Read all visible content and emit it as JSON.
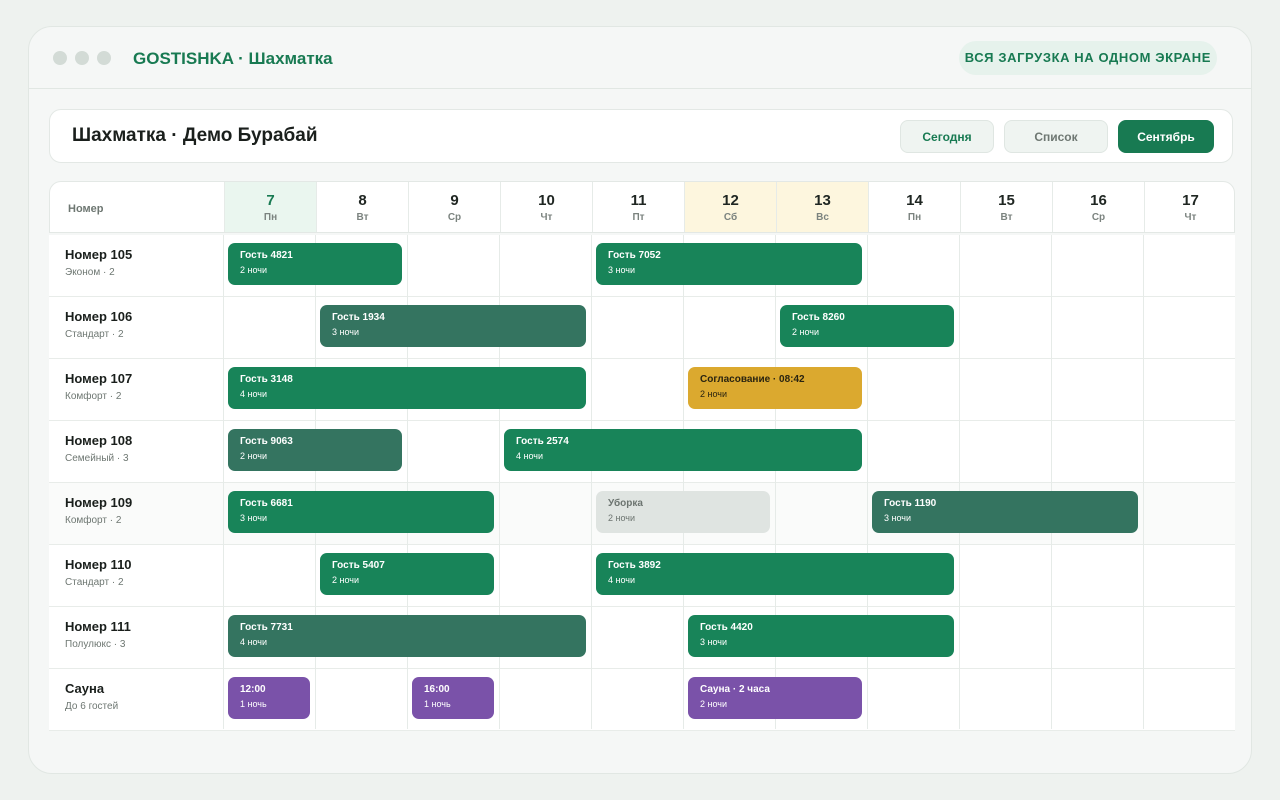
{
  "app": {
    "title": "GOSTISHKA · Шахматка",
    "tagline": "ВСЯ ЗАГРУЗКА НА ОДНОМ ЭКРАНЕ"
  },
  "toolbar": {
    "title": "Шахматка · Демо Бурабай",
    "today_label": "Сегодня",
    "list_label": "Список",
    "month_label": "Сентябрь"
  },
  "grid": {
    "room_header": "Номер",
    "days": [
      {
        "num": "7",
        "dow": "Пн",
        "state": "today"
      },
      {
        "num": "8",
        "dow": "Вт",
        "state": ""
      },
      {
        "num": "9",
        "dow": "Ср",
        "state": ""
      },
      {
        "num": "10",
        "dow": "Чт",
        "state": ""
      },
      {
        "num": "11",
        "dow": "Пт",
        "state": ""
      },
      {
        "num": "12",
        "dow": "Сб",
        "state": "weekend"
      },
      {
        "num": "13",
        "dow": "Вс",
        "state": "weekend"
      },
      {
        "num": "14",
        "dow": "Пн",
        "state": ""
      },
      {
        "num": "15",
        "dow": "Вт",
        "state": ""
      },
      {
        "num": "16",
        "dow": "Ср",
        "state": ""
      },
      {
        "num": "17",
        "dow": "Чт",
        "state": ""
      }
    ],
    "rooms": [
      {
        "name": "Номер 105",
        "sub": "Эконом · 2",
        "bookings": [
          {
            "title": "Гость 4821",
            "sub": "2 ночи",
            "start": 0,
            "span": 2,
            "color": "green"
          },
          {
            "title": "Гость 7052",
            "sub": "3 ночи",
            "start": 4,
            "span": 3,
            "color": "green"
          }
        ]
      },
      {
        "name": "Номер 106",
        "sub": "Стандарт · 2",
        "bookings": [
          {
            "title": "Гость 1934",
            "sub": "3 ночи",
            "start": 1,
            "span": 3,
            "color": "dark"
          },
          {
            "title": "Гость 8260",
            "sub": "2 ночи",
            "start": 6,
            "span": 2,
            "color": "green"
          }
        ]
      },
      {
        "name": "Номер 107",
        "sub": "Комфорт · 2",
        "bookings": [
          {
            "title": "Гость 3148",
            "sub": "4 ночи",
            "start": 0,
            "span": 4,
            "color": "green"
          },
          {
            "title": "Согласование · 08:42",
            "sub": "2 ночи",
            "start": 5,
            "span": 2,
            "color": "yellow"
          }
        ]
      },
      {
        "name": "Номер 108",
        "sub": "Семейный · 3",
        "bookings": [
          {
            "title": "Гость 9063",
            "sub": "2 ночи",
            "start": 0,
            "span": 2,
            "color": "dark"
          },
          {
            "title": "Гость 2574",
            "sub": "4 ночи",
            "start": 3,
            "span": 4,
            "color": "green"
          }
        ]
      },
      {
        "name": "Номер 109",
        "sub": "Комфорт · 2",
        "bookings": [
          {
            "title": "Гость 6681",
            "sub": "3 ночи",
            "start": 0,
            "span": 3,
            "color": "green"
          },
          {
            "title": "Уборка",
            "sub": "2 ночи",
            "start": 4,
            "span": 2,
            "color": "grey"
          },
          {
            "title": "Гость 1190",
            "sub": "3 ночи",
            "start": 7,
            "span": 3,
            "color": "dark"
          }
        ]
      },
      {
        "name": "Номер 110",
        "sub": "Стандарт · 2",
        "bookings": [
          {
            "title": "Гость 5407",
            "sub": "2 ночи",
            "start": 1,
            "span": 2,
            "color": "green"
          },
          {
            "title": "Гость 3892",
            "sub": "4 ночи",
            "start": 4,
            "span": 4,
            "color": "green"
          }
        ]
      },
      {
        "name": "Номер 111",
        "sub": "Полулюкс · 3",
        "bookings": [
          {
            "title": "Гость 7731",
            "sub": "4 ночи",
            "start": 0,
            "span": 4,
            "color": "dark"
          },
          {
            "title": "Гость 4420",
            "sub": "3 ночи",
            "start": 5,
            "span": 3,
            "color": "green"
          }
        ]
      },
      {
        "name": "Сауна",
        "sub": "До 6 гостей",
        "bookings": [
          {
            "title": "12:00",
            "sub": "1 ночь",
            "start": 0,
            "span": 1,
            "color": "purple"
          },
          {
            "title": "16:00",
            "sub": "1 ночь",
            "start": 2,
            "span": 1,
            "color": "purple"
          },
          {
            "title": "Сауна · 2 часа",
            "sub": "2 ночи",
            "start": 5,
            "span": 2,
            "color": "purple"
          }
        ]
      }
    ]
  }
}
